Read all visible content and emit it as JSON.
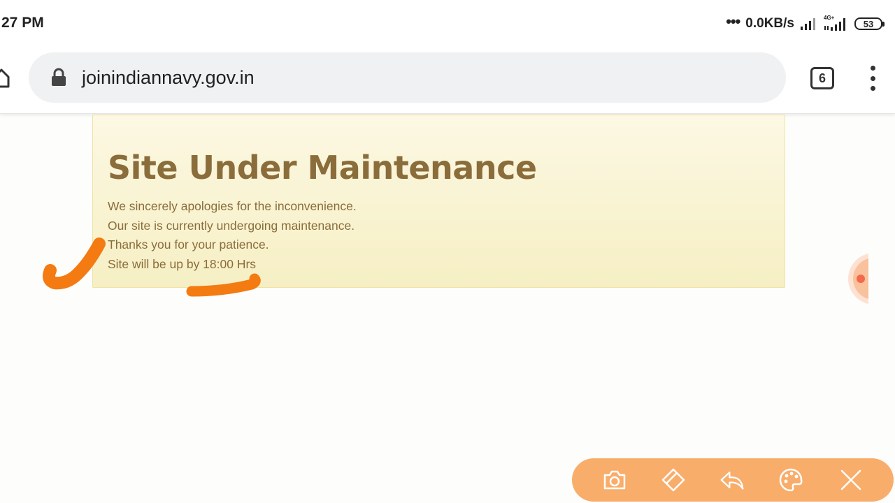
{
  "status_bar": {
    "time": "27 PM",
    "dots": "•••",
    "net_speed": "0.0KB/s",
    "net_type": "4G+",
    "battery": "53"
  },
  "browser": {
    "url": "joinindiannavy.gov.in",
    "tab_count": "6"
  },
  "page": {
    "title": "Site Under Maintenance",
    "lines": [
      "We sincerely apologies for the inconvenience.",
      "Our site is currently undergoing maintenance.",
      "Thanks you for your patience.",
      "Site will be up by 18:00 Hrs"
    ],
    "colors": {
      "alert_background": "#fcf8e3",
      "alert_text": "#8a6d3b",
      "annotation": "#f47a12"
    }
  },
  "drawing_toolbar": {
    "tools": [
      "camera-icon",
      "eraser-icon",
      "undo-icon",
      "palette-icon",
      "close-icon"
    ],
    "background": "#f8ad6a"
  }
}
